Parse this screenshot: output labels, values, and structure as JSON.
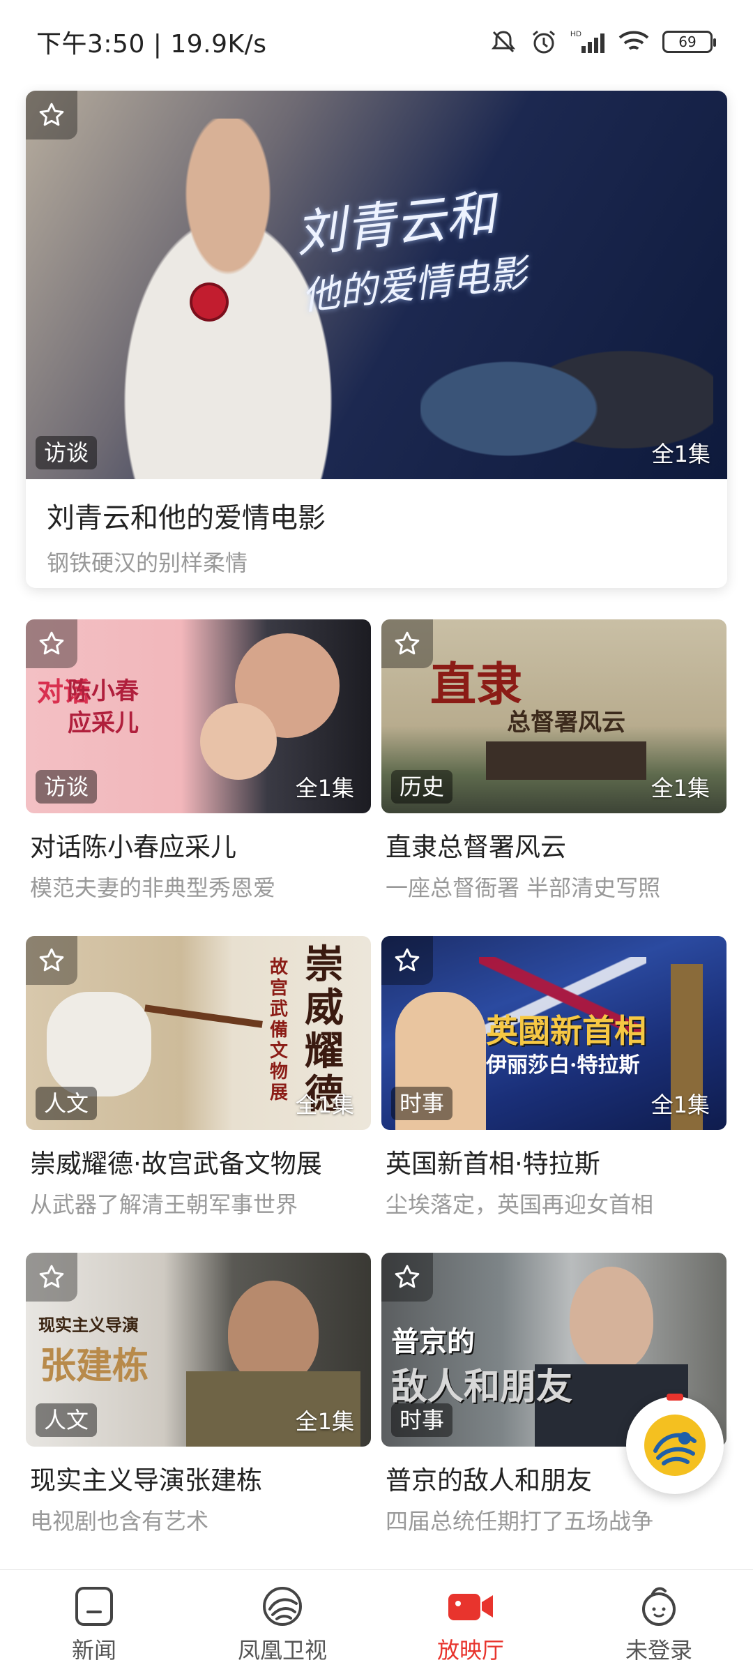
{
  "status_bar": {
    "time_speed": "下午3:50 | 19.9K/s",
    "battery": "69"
  },
  "hero": {
    "image_text_line1": "刘青云和",
    "image_text_line2": "他的爱情电影",
    "tag": "访谈",
    "count": "全1集",
    "title": "刘青云和他的爱情电影",
    "subtitle": "钢铁硬汉的别样柔情"
  },
  "cards": [
    {
      "image_text_a": "对话",
      "image_text_b": "陈小春",
      "image_text_c": "应采儿",
      "tag": "访谈",
      "count": "全1集",
      "title": "对话陈小春应采儿",
      "subtitle": "模范夫妻的非典型秀恩爱"
    },
    {
      "image_text_a": "直隶",
      "image_text_b": "总督署风云",
      "tag": "历史",
      "count": "全1集",
      "title": "直隶总督署风云",
      "subtitle": "一座总督衙署 半部清史写照"
    },
    {
      "image_text_a": "崇威耀德",
      "image_text_b": "故宫武備文物展",
      "tag": "人文",
      "count": "全1集",
      "title": "崇威耀德·故宫武备文物展",
      "subtitle": "从武器了解清王朝军事世界"
    },
    {
      "image_text_a": "英國新首相",
      "image_text_b": "伊丽莎白·特拉斯",
      "tag": "时事",
      "count": "全1集",
      "title": "英国新首相·特拉斯",
      "subtitle": "尘埃落定，英国再迎女首相"
    },
    {
      "image_text_a": "现实主义导演",
      "image_text_b": "张建栋",
      "tag": "人文",
      "count": "全1集",
      "title": "现实主义导演张建栋",
      "subtitle": "电视剧也含有艺术"
    },
    {
      "image_text_a": "普京的",
      "image_text_b": "敌人和朋友",
      "tag": "时事",
      "count": "",
      "title": "普京的敌人和朋友",
      "subtitle": "四届总统任期打了五场战争"
    }
  ],
  "tabbar": {
    "items": [
      {
        "label": "新闻",
        "icon": "news-icon"
      },
      {
        "label": "凤凰卫视",
        "icon": "phoenix-icon"
      },
      {
        "label": "放映厅",
        "icon": "video-camera-icon"
      },
      {
        "label": "未登录",
        "icon": "user-icon"
      }
    ],
    "active_index": 2
  },
  "colors": {
    "accent": "#e8342d",
    "text": "#222222",
    "subtext": "#999999"
  }
}
